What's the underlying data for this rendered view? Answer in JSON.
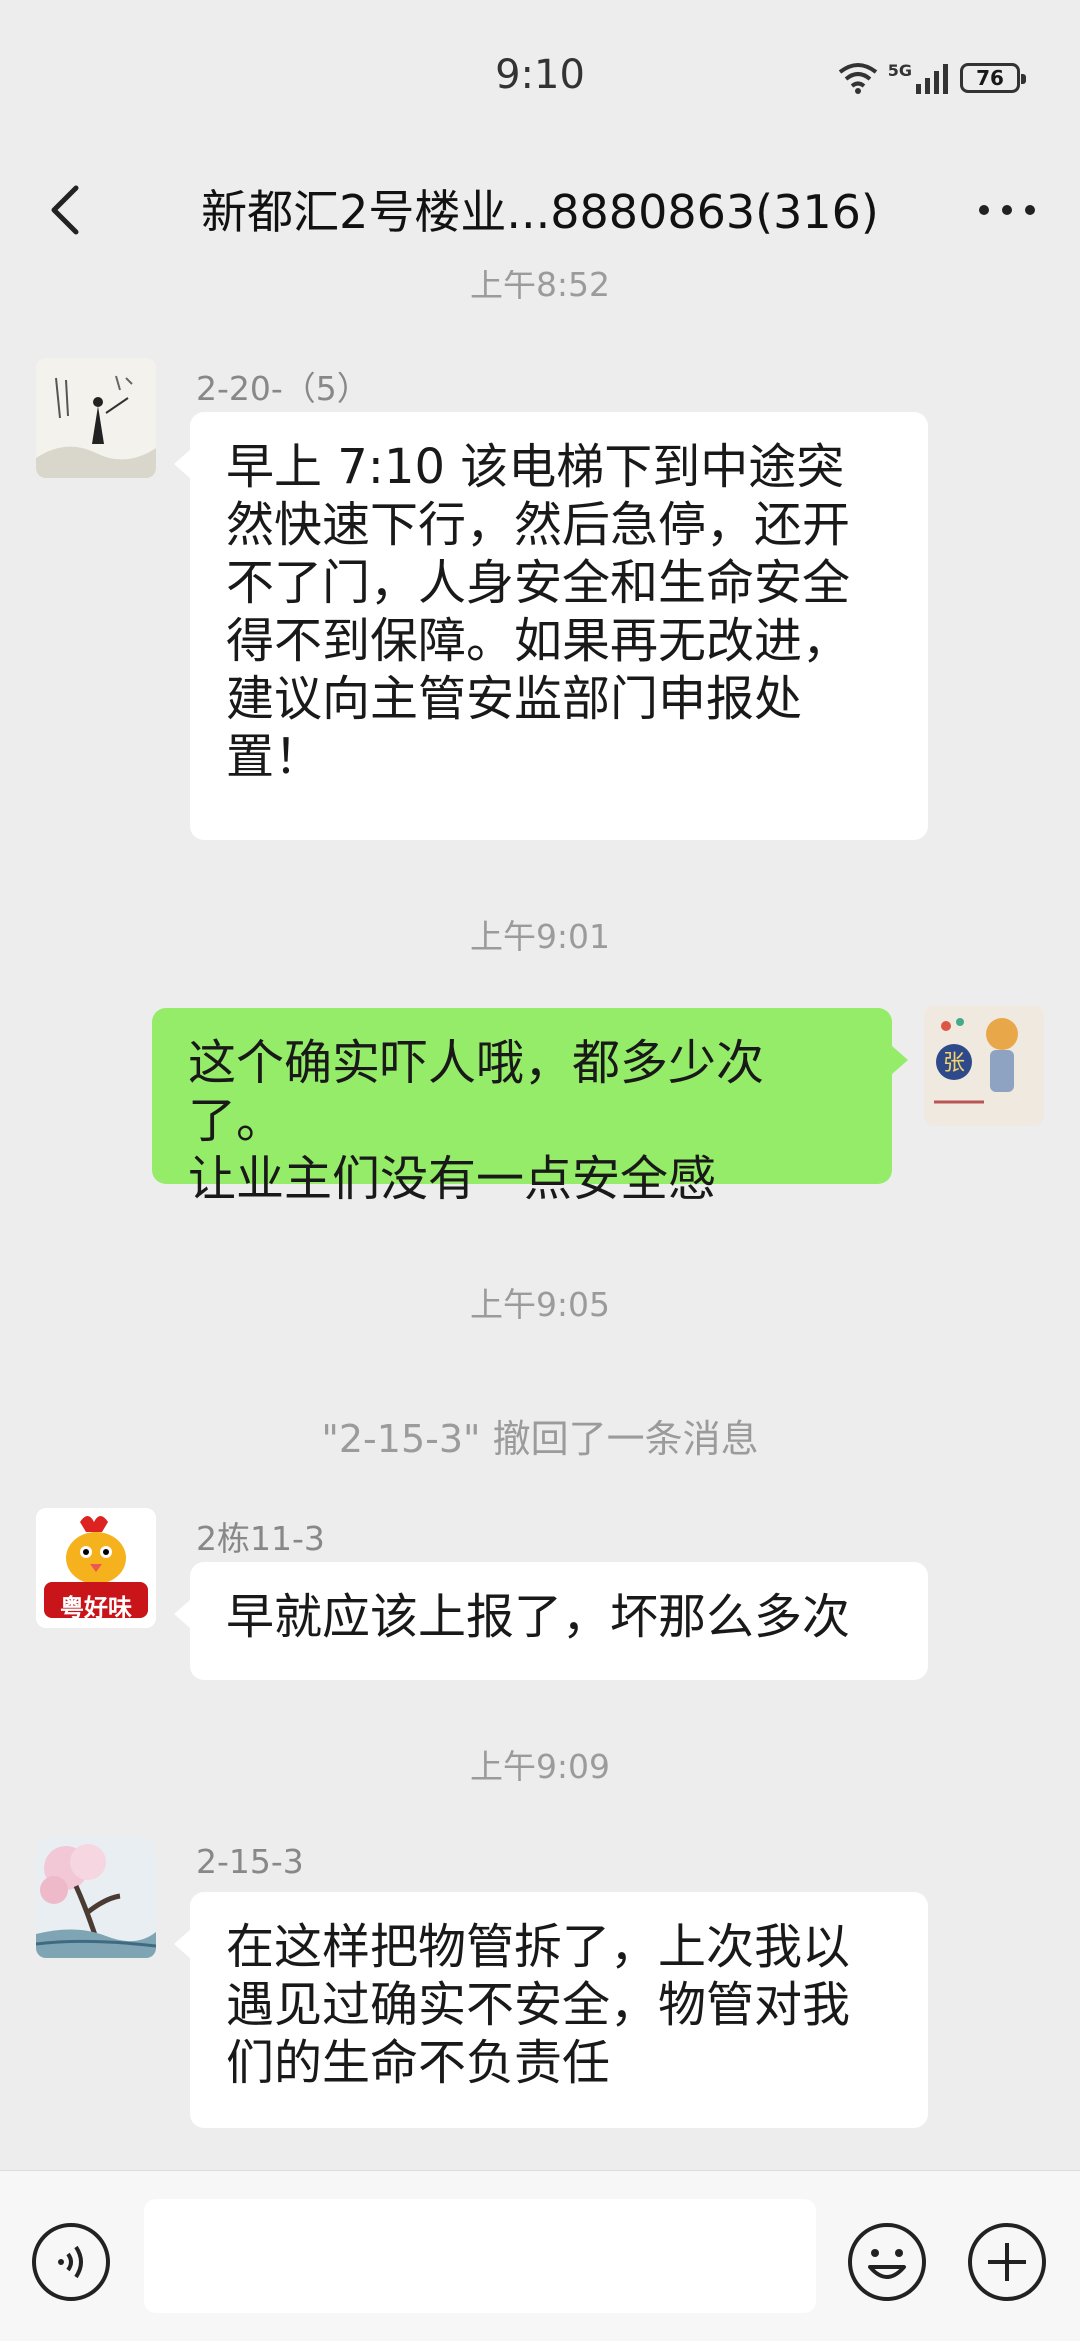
{
  "status_bar": {
    "time": "9:10",
    "network": "5G",
    "battery": "76"
  },
  "header": {
    "title": "新都汇2号楼业...8880863(316)"
  },
  "messages": [
    {
      "type": "time",
      "text": "上午8:52"
    },
    {
      "type": "incoming",
      "sender": "2-20-（5）",
      "avatar": "ink-painting-avatar",
      "lines": [
        "早上 7:10 该电梯下到中途突",
        "然快速下行，然后急停，还开",
        "不了门，人身安全和生命安全",
        "得不到保障。如果再无改进，",
        "建议向主管安监部门申报处",
        "置！"
      ]
    },
    {
      "type": "time",
      "text": "上午9:01"
    },
    {
      "type": "outgoing",
      "avatar": "cartoon-girl-avatar",
      "lines": [
        "这个确实吓人哦，都多少次了。",
        "让业主们没有一点安全感"
      ]
    },
    {
      "type": "time",
      "text": "上午9:05"
    },
    {
      "type": "system",
      "text": "\"2-15-3\" 撤回了一条消息"
    },
    {
      "type": "incoming",
      "sender": "2栋11-3",
      "avatar": "chicken-logo-avatar",
      "avatar_text": "粤好味",
      "lines": [
        "早就应该上报了，坏那么多次"
      ]
    },
    {
      "type": "time",
      "text": "上午9:09"
    },
    {
      "type": "incoming",
      "sender": "2-15-3",
      "avatar": "blossom-tree-avatar",
      "lines": [
        "在这样把物管拆了，上次我以",
        "遇见过确实不安全，物管对我",
        "们的生命不负责任"
      ]
    }
  ],
  "input_bar": {
    "placeholder": ""
  },
  "colors": {
    "background": "#ededed",
    "outgoing_bubble": "#95ec69",
    "incoming_bubble": "#ffffff",
    "meta_text": "#9b9b9b"
  }
}
